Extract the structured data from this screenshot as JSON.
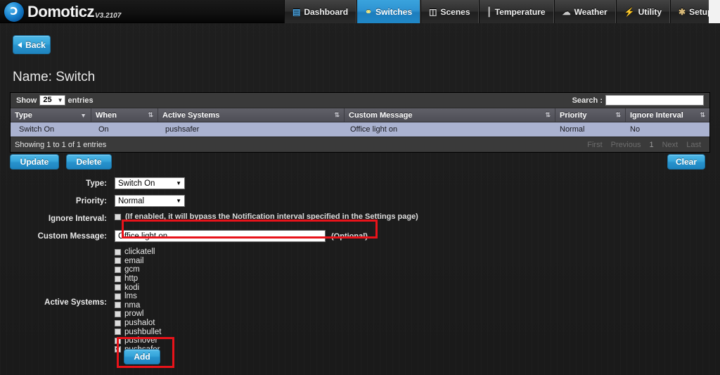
{
  "brand": {
    "name": "Domoticz",
    "version": "V3.2107",
    "logo_icon": "domoticz-logo-icon"
  },
  "nav": {
    "items": [
      {
        "label": "Dashboard",
        "icon": "dashboard-icon",
        "glyph": "▤",
        "color": "#4aa3e0",
        "active": false,
        "dropdown": false
      },
      {
        "label": "Switches",
        "icon": "lightbulb-icon",
        "glyph": "💡",
        "color": "#f4e06a",
        "active": true,
        "dropdown": false
      },
      {
        "label": "Scenes",
        "icon": "scenes-icon",
        "glyph": "🎬",
        "color": "#cfcfcf",
        "active": false,
        "dropdown": false
      },
      {
        "label": "Temperature",
        "icon": "thermometer-icon",
        "glyph": "🌡",
        "color": "#d8d8d8",
        "active": false,
        "dropdown": false
      },
      {
        "label": "Weather",
        "icon": "weather-icon",
        "glyph": "☁",
        "color": "#bfbfbf",
        "active": false,
        "dropdown": false
      },
      {
        "label": "Utility",
        "icon": "utility-icon",
        "glyph": "⚡",
        "color": "#e8d24a",
        "active": false,
        "dropdown": false
      },
      {
        "label": "Setup",
        "icon": "tools-icon",
        "glyph": "🔧",
        "color": "#d0b070",
        "active": false,
        "dropdown": true
      }
    ]
  },
  "back_button": {
    "label": "Back",
    "icon": "arrow-left-icon"
  },
  "page_title": "Name: Switch",
  "table": {
    "length_label_before": "Show",
    "length_value": "25",
    "length_label_after": "entries",
    "search_label": "Search :",
    "search_value": "",
    "search_placeholder": "",
    "columns": [
      {
        "label": "Type",
        "sort": "desc"
      },
      {
        "label": "When",
        "sort": "none"
      },
      {
        "label": "Active Systems",
        "sort": "none"
      },
      {
        "label": "Custom Message",
        "sort": "none"
      },
      {
        "label": "Priority",
        "sort": "none"
      },
      {
        "label": "Ignore Interval",
        "sort": "none"
      }
    ],
    "rows": [
      {
        "type": "Switch On",
        "when": "On",
        "active_systems": "pushsafer",
        "custom_message": "Office light on",
        "priority": "Normal",
        "ignore_interval": "No"
      }
    ],
    "showing_info": "Showing 1 to 1 of 1 entries",
    "pagination": [
      {
        "label": "First",
        "current": false
      },
      {
        "label": "Previous",
        "current": false
      },
      {
        "label": "1",
        "current": true
      },
      {
        "label": "Next",
        "current": false
      },
      {
        "label": "Last",
        "current": false
      }
    ]
  },
  "actions": {
    "update_label": "Update",
    "delete_label": "Delete",
    "clear_label": "Clear",
    "add_label": "Add"
  },
  "form": {
    "type_label": "Type:",
    "type_value": "Switch On",
    "priority_label": "Priority:",
    "priority_value": "Normal",
    "ignore_interval_label": "Ignore Interval:",
    "ignore_interval_checked": false,
    "ignore_interval_hint": "(If enabled, it will bypass the Notification interval specified in the Settings page)",
    "custom_message_label": "Custom Message:",
    "custom_message_value": "Office light on",
    "custom_message_optional": "(Optional)",
    "active_systems_label": "Active Systems:",
    "active_systems": [
      {
        "name": "clickatell",
        "checked": false
      },
      {
        "name": "email",
        "checked": false
      },
      {
        "name": "gcm",
        "checked": false
      },
      {
        "name": "http",
        "checked": false
      },
      {
        "name": "kodi",
        "checked": false
      },
      {
        "name": "lms",
        "checked": false
      },
      {
        "name": "nma",
        "checked": false
      },
      {
        "name": "prowl",
        "checked": false
      },
      {
        "name": "pushalot",
        "checked": false
      },
      {
        "name": "pushbullet",
        "checked": false
      },
      {
        "name": "pushover",
        "checked": false
      },
      {
        "name": "pushsafer",
        "checked": true
      }
    ]
  },
  "annotations": {
    "highlight_color": "#e8131a",
    "boxes": [
      {
        "name": "custom-message-highlight"
      },
      {
        "name": "pushsafer-add-highlight"
      }
    ]
  }
}
